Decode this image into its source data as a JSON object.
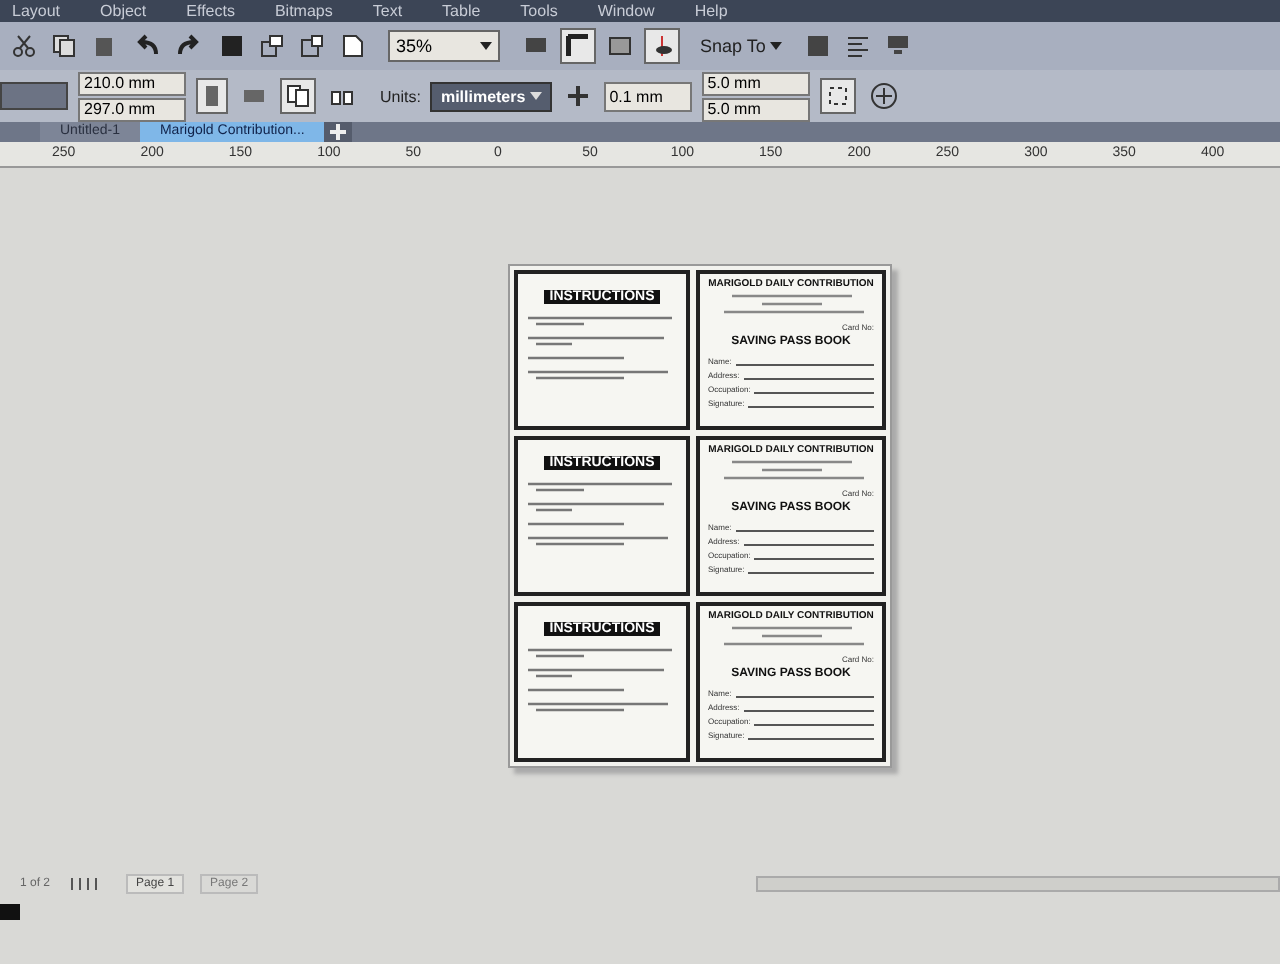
{
  "menu": [
    "Layout",
    "Object",
    "Effects",
    "Bitmaps",
    "Text",
    "Table",
    "Tools",
    "Window",
    "Help"
  ],
  "toolbar": {
    "zoom": "35%",
    "snap": "Snap To"
  },
  "property_bar": {
    "width": "210.0 mm",
    "height": "297.0 mm",
    "units_label": "Units:",
    "units": "millimeters",
    "nudge": "0.1 mm",
    "dup_x": "5.0 mm",
    "dup_y": "5.0 mm"
  },
  "tabs": [
    {
      "label": "Untitled-1",
      "selected": false
    },
    {
      "label": "Marigold Contribution...",
      "selected": true
    }
  ],
  "ruler": [
    "250",
    "200",
    "150",
    "100",
    "50",
    "0",
    "50",
    "100",
    "150",
    "200",
    "250",
    "300",
    "350",
    "400"
  ],
  "cards": [
    {
      "instructions_title": "INSTRUCTIONS",
      "title": "MARIGOLD DAILY CONTRIBUTION",
      "card_no": "Card No:",
      "heading": "SAVING PASS BOOK",
      "fields": [
        "Name:",
        "Address:",
        "Occupation:",
        "Signature:"
      ]
    },
    {
      "instructions_title": "INSTRUCTIONS",
      "title": "MARIGOLD DAILY CONTRIBUTION",
      "card_no": "Card No:",
      "heading": "SAVING PASS BOOK",
      "fields": [
        "Name:",
        "Address:",
        "Occupation:",
        "Signature:"
      ]
    },
    {
      "instructions_title": "INSTRUCTIONS",
      "title": "MARIGOLD DAILY CONTRIBUTION",
      "card_no": "Card No:",
      "heading": "SAVING PASS BOOK",
      "fields": [
        "Name:",
        "Address:",
        "Occupation:",
        "Signature:"
      ]
    }
  ],
  "status": {
    "page_counter": "1 of 2",
    "pages": [
      {
        "label": "Page 1",
        "selected": true
      },
      {
        "label": "Page 2",
        "selected": false
      }
    ]
  }
}
